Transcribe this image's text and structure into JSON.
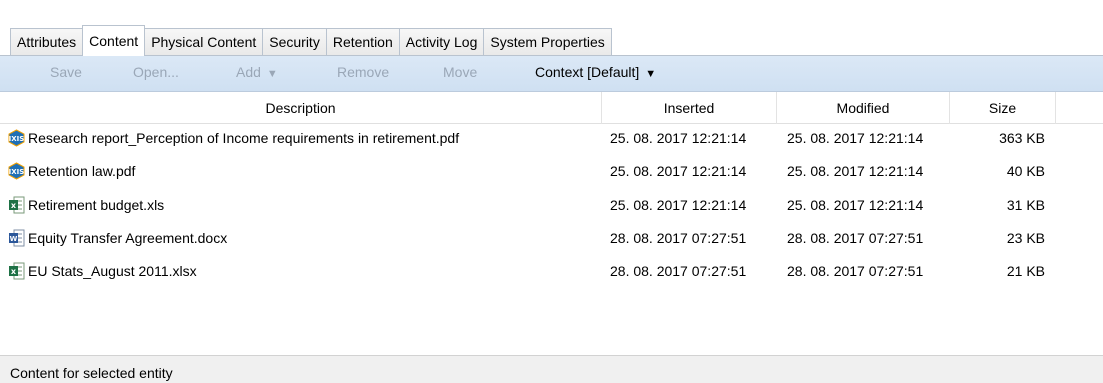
{
  "tabs": [
    {
      "label": "Attributes"
    },
    {
      "label": "Content"
    },
    {
      "label": "Physical Content"
    },
    {
      "label": "Security"
    },
    {
      "label": "Retention"
    },
    {
      "label": "Activity Log"
    },
    {
      "label": "System Properties"
    }
  ],
  "active_tab": "Content",
  "toolbar": {
    "save_label": "Save",
    "open_label": "Open...",
    "add_label": "Add",
    "remove_label": "Remove",
    "move_label": "Move",
    "context_label": "Context [Default]"
  },
  "table": {
    "columns": {
      "description": "Description",
      "inserted": "Inserted",
      "modified": "Modified",
      "size": "Size"
    },
    "rows": [
      {
        "icon": "pdf-document-icon",
        "description": "Research report_Perception of Income requirements in retirement.pdf",
        "inserted": "25. 08. 2017 12:21:14",
        "modified": "25. 08. 2017 12:21:14",
        "size": "363 KB"
      },
      {
        "icon": "pdf-document-icon",
        "description": "Retention law.pdf",
        "inserted": "25. 08. 2017 12:21:14",
        "modified": "25. 08. 2017 12:21:14",
        "size": "40 KB"
      },
      {
        "icon": "excel-document-icon",
        "description": "Retirement budget.xls",
        "inserted": "25. 08. 2017 12:21:14",
        "modified": "25. 08. 2017 12:21:14",
        "size": "31 KB"
      },
      {
        "icon": "word-document-icon",
        "description": "Equity Transfer Agreement.docx",
        "inserted": "28. 08. 2017 07:27:51",
        "modified": "28. 08. 2017 07:27:51",
        "size": "23 KB"
      },
      {
        "icon": "excel-document-icon",
        "description": "EU Stats_August 2011.xlsx",
        "inserted": "28. 08. 2017 07:27:51",
        "modified": "28. 08. 2017 07:27:51",
        "size": "21 KB"
      }
    ]
  },
  "status": {
    "text": "Content for selected entity"
  },
  "colors": {
    "toolbar_bg": "#d6e5f5",
    "disabled_text": "#9aa7b7",
    "tab_border": "#b9c3cf"
  }
}
